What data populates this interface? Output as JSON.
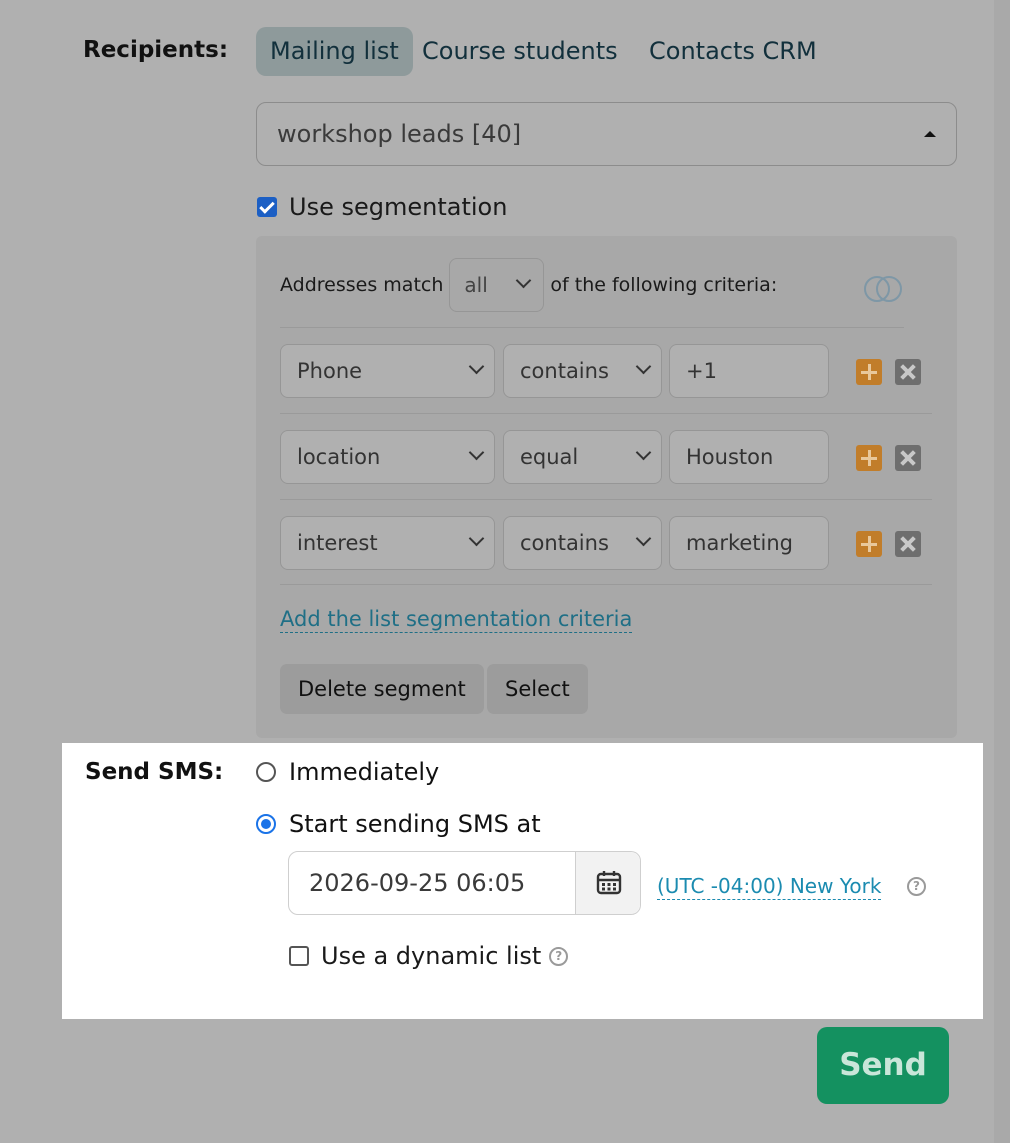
{
  "recipients": {
    "label": "Recipients:",
    "tabs": [
      {
        "label": "Mailing list",
        "active": true
      },
      {
        "label": "Course students",
        "active": false
      },
      {
        "label": "Contacts CRM",
        "active": false
      }
    ],
    "list_select_value": "workshop leads [40]"
  },
  "segmentation": {
    "checkbox_label": "Use segmentation",
    "checked": true,
    "match_prefix": "Addresses match",
    "match_value": "all",
    "match_suffix": "of the following criteria:",
    "criteria": [
      {
        "field": "Phone",
        "operator": "contains",
        "value": "+1"
      },
      {
        "field": "location",
        "operator": "equal",
        "value": "Houston"
      },
      {
        "field": "interest",
        "operator": "contains",
        "value": "marketing"
      }
    ],
    "add_link": "Add the list segmentation criteria",
    "delete_button": "Delete segment",
    "select_button": "Select"
  },
  "send_sms": {
    "label": "Send SMS:",
    "option_immediately": "Immediately",
    "option_scheduled": "Start sending SMS at",
    "selected": "scheduled",
    "datetime": "2026-09-25 06:05",
    "timezone": "(UTC -04:00) New York",
    "dynamic_list_label": "Use a dynamic list",
    "dynamic_list_checked": false
  },
  "send_button": "Send",
  "icons": {
    "calendar": "calendar-icon",
    "help": "help-icon",
    "venn": "venn-icon",
    "add": "plus-icon",
    "remove": "close-icon"
  },
  "colors": {
    "send": "#149160",
    "link": "#1b8bb0",
    "add_button": "#c17d2a",
    "radio_selected": "#1a73e8"
  }
}
